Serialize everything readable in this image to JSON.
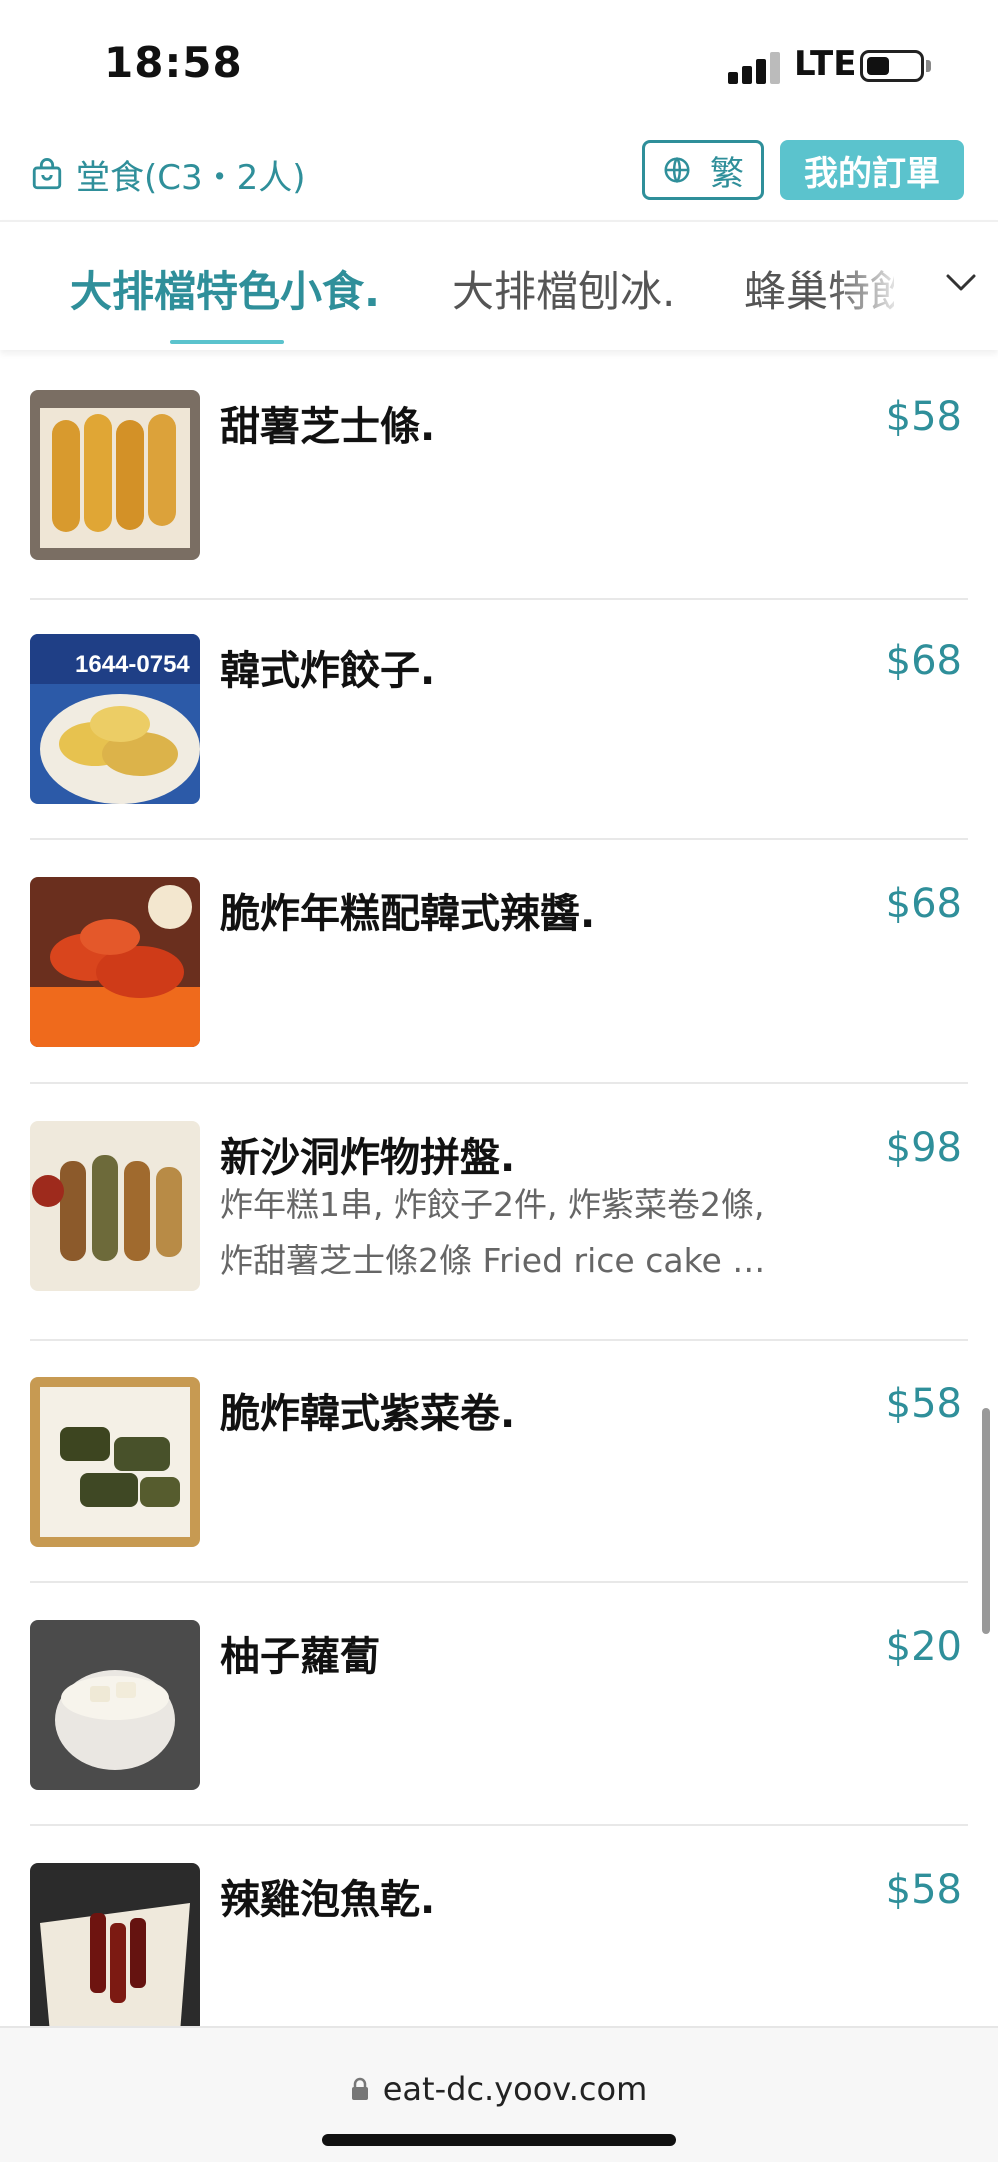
{
  "status_bar": {
    "time": "18:58",
    "network": "LTE"
  },
  "header": {
    "dine_in": "堂食(C3・2人)",
    "language_label": "繁",
    "orders_label": "我的訂單"
  },
  "categories": {
    "tabs": [
      "大排檔特色小食.",
      "大排檔刨冰.",
      "蜂巢特飲"
    ],
    "active_index": 0
  },
  "menu": {
    "items": [
      {
        "name": "甜薯芝士條.",
        "price": "$58",
        "description": ""
      },
      {
        "name": "韓式炸餃子.",
        "price": "$68",
        "description": ""
      },
      {
        "name": "脆炸年糕配韓式辣醬.",
        "price": "$68",
        "description": ""
      },
      {
        "name": "新沙洞炸物拼盤.",
        "price": "$98",
        "description_line1": "炸年糕1串, 炸餃子2件, 炸紫菜卷2條,",
        "description_line2": "炸甜薯芝士條2條 Fried rice cake …"
      },
      {
        "name": "脆炸韓式紫菜卷.",
        "price": "$58",
        "description": ""
      },
      {
        "name": "柚子蘿蔔",
        "price": "$20",
        "description": ""
      },
      {
        "name": "辣雞泡魚乾.",
        "price": "$58",
        "description": ""
      }
    ],
    "photo_text_item2": "1644-0754"
  },
  "browser": {
    "url": "eat-dc.yoov.com"
  },
  "colors": {
    "accent": "#2f8f9a",
    "accent_fill": "#5bc3cd"
  },
  "icons": [
    "bag-icon",
    "globe-icon",
    "chevron-down-icon",
    "lock-icon",
    "signal-icon",
    "battery-icon"
  ]
}
